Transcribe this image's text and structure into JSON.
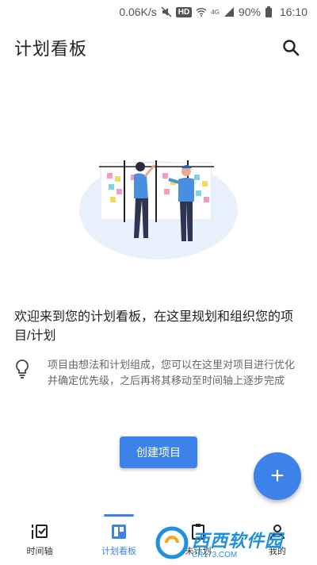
{
  "status_bar": {
    "speed": "0.06K/s",
    "hd": "HD",
    "network": "4G",
    "battery": "90%",
    "time": "16:10"
  },
  "app_bar": {
    "title": "计划看板"
  },
  "welcome": {
    "text": "欢迎来到您的计划看板，在这里规划和组织您的项目/计划"
  },
  "tip": {
    "text": "项目由想法和计划组成，您可以在这里对项目进行优化并确定优先级，之后再将其移动至时间轴上逐步完成"
  },
  "create_button": {
    "label": "创建项目"
  },
  "fab": {
    "label": "+"
  },
  "bottom_nav": {
    "items": [
      {
        "label": "时间轴",
        "icon": "timeline-icon",
        "active": false
      },
      {
        "label": "计划看板",
        "icon": "board-icon",
        "active": true
      },
      {
        "label": "未计划",
        "icon": "unplanned-icon",
        "active": false
      },
      {
        "label": "我的",
        "icon": "profile-icon",
        "active": false
      }
    ]
  },
  "watermark": {
    "name": "西西软件园",
    "url": "CR173.COM"
  },
  "colors": {
    "accent": "#3d82e8",
    "watermark": "#1f8fe0"
  }
}
